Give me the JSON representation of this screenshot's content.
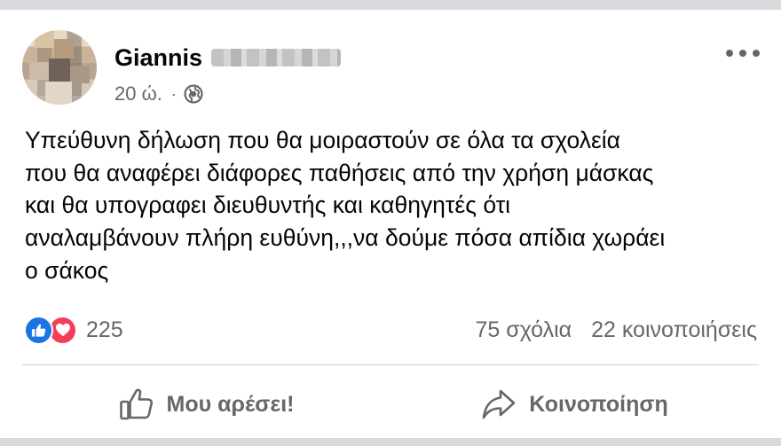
{
  "post": {
    "author": "Giannis",
    "time": "20 ώ.",
    "separator": "·",
    "privacy_icon": "globe-icon",
    "more_icon": "more-options-icon",
    "text_lines": [
      "Υπεύθυνη δήλωση που θα μοιραστούν σε όλα τα σχολεία",
      "που θα αναφέρει διάφορες παθήσεις από την χρήση μάσκας",
      "και θα υπογραφει διευθυντής και καθηγητές ότι",
      "αναλαμβάνουν πλήρη ευθύνη,,,να δούμε πόσα απίδια χωράει",
      "ο σάκος"
    ]
  },
  "reactions": {
    "icons": [
      "like-reaction-icon",
      "love-reaction-icon"
    ],
    "count": "225",
    "comments": "75 σχόλια",
    "shares": "22 κοινοποιήσεις"
  },
  "actions": {
    "like_label": "Μου αρέσει!",
    "share_label": "Κοινοποίηση"
  },
  "colors": {
    "like_blue": "#1b74e4",
    "love_red": "#f33e58",
    "secondary_text": "#65676b",
    "divider": "#ced0d4",
    "band": "#d9dadd"
  }
}
